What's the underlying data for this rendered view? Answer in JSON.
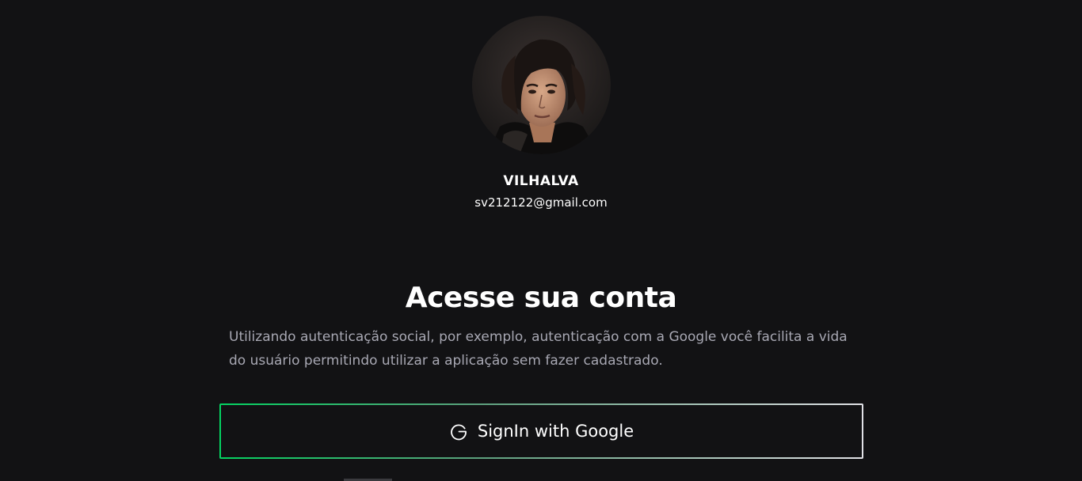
{
  "user": {
    "name": "VILHALVA",
    "email": "sv212122@gmail.com"
  },
  "login": {
    "title": "Acesse sua conta",
    "description": "Utilizando autenticação social, por exemplo, autenticação com a Google você facilita a vida do usuário permitindo utilizar a aplicação sem fazer cadastrado.",
    "google_button_label": "SignIn with Google",
    "google_icon": "google-g-icon"
  },
  "colors": {
    "background": "#121214",
    "text_primary": "#ffffff",
    "text_secondary": "#a8a8b3",
    "button_border_start": "#04d361",
    "button_border_end": "#e1e1e6"
  }
}
